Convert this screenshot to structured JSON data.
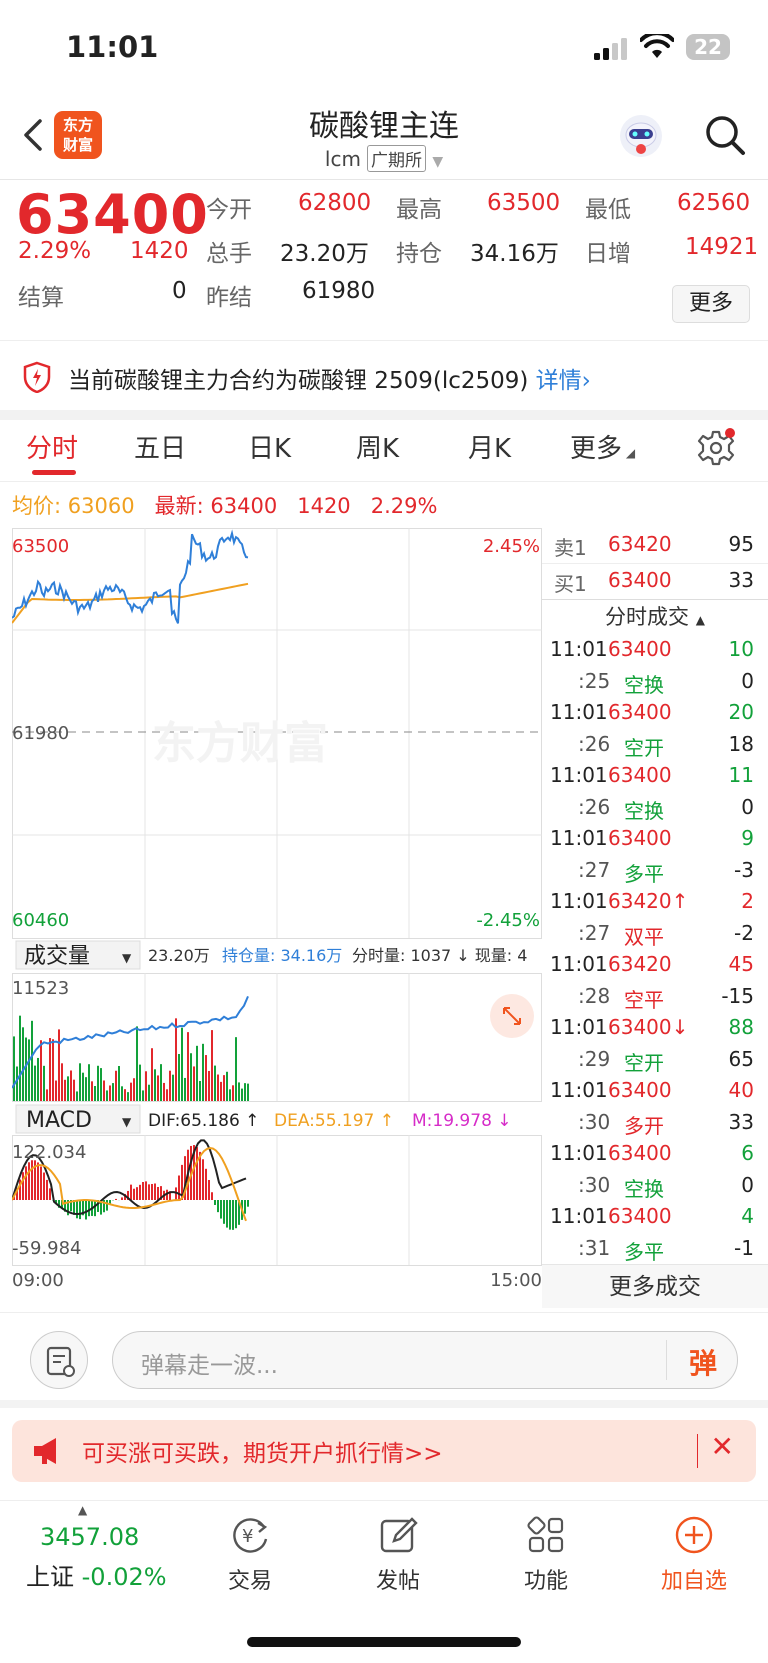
{
  "status_bar": {
    "time": "11:01",
    "battery": "22"
  },
  "header": {
    "logo_line1": "东方",
    "logo_line2": "财富",
    "title": "碳酸锂主连",
    "symbol": "lcm",
    "exchange": "广期所"
  },
  "quote": {
    "last": "63400",
    "pct": "2.29%",
    "change": "1420",
    "open_label": "今开",
    "open": "62800",
    "high_label": "最高",
    "high": "63500",
    "low_label": "最低",
    "low": "62560",
    "volume_label": "总手",
    "volume": "23.20万",
    "oi_label": "持仓",
    "oi": "34.16万",
    "daily_inc_label": "日增",
    "daily_inc": "14921",
    "settle_label": "结算",
    "settle": "0",
    "prev_settle_label": "昨结",
    "prev_settle": "61980",
    "more": "更多"
  },
  "notice": {
    "text": "当前碳酸锂主力合约为碳酸锂 2509(lc2509)",
    "link": "详情"
  },
  "tabs": [
    "分时",
    "五日",
    "日K",
    "周K",
    "月K",
    "更多"
  ],
  "avg_bar": {
    "avg_label": "均价:",
    "avg": "63060",
    "latest_label": "最新:",
    "latest": "63400",
    "change": "1420",
    "pct": "2.29%"
  },
  "price_chart": {
    "top": "63500",
    "mid": "61980",
    "bottom": "60460",
    "top_pct": "2.45%",
    "bottom_pct": "-2.45%",
    "watermark": "东方财富"
  },
  "volume_panel": {
    "label": "成交量",
    "text1": "23.20万",
    "text2": "持仓量: 34.16万",
    "text3": "分时量: 1037 ↓ 现量: 4",
    "max": "11523"
  },
  "macd_panel": {
    "label": "MACD",
    "dif": "DIF:65.186 ↑",
    "dea": "DEA:55.197 ↑",
    "m": "M:19.978 ↓",
    "top": "122.034",
    "bottom": "-59.984",
    "time_start": "09:00",
    "time_end": "15:00"
  },
  "orderbook": [
    {
      "label": "卖1",
      "price": "63420",
      "qty": "95"
    },
    {
      "label": "买1",
      "price": "63400",
      "qty": "33"
    }
  ],
  "ticks_header": "分时成交",
  "ticks": [
    {
      "t": "11:01",
      "p": "63400",
      "v": "10",
      "vc": "green"
    },
    {
      "t": ":25",
      "p": "空换",
      "v": "0",
      "pc": "green"
    },
    {
      "t": "11:01",
      "p": "63400",
      "v": "20",
      "vc": "green"
    },
    {
      "t": ":26",
      "p": "空开",
      "v": "18",
      "pc": "green"
    },
    {
      "t": "11:01",
      "p": "63400",
      "v": "11",
      "vc": "green"
    },
    {
      "t": ":26",
      "p": "空换",
      "v": "0",
      "pc": "green"
    },
    {
      "t": "11:01",
      "p": "63400",
      "v": "9",
      "vc": "green"
    },
    {
      "t": ":27",
      "p": "多平",
      "v": "-3",
      "pc": "green"
    },
    {
      "t": "11:01",
      "p": "63420↑",
      "v": "2",
      "vc": "red"
    },
    {
      "t": ":27",
      "p": "双平",
      "v": "-2",
      "pc": "red"
    },
    {
      "t": "11:01",
      "p": "63420",
      "v": "45",
      "vc": "red"
    },
    {
      "t": ":28",
      "p": "空平",
      "v": "-15",
      "pc": "red"
    },
    {
      "t": "11:01",
      "p": "63400↓",
      "v": "88",
      "vc": "green"
    },
    {
      "t": ":29",
      "p": "空开",
      "v": "65",
      "pc": "green"
    },
    {
      "t": "11:01",
      "p": "63400",
      "v": "40",
      "vc": "red"
    },
    {
      "t": ":30",
      "p": "多开",
      "v": "33",
      "pc": "red"
    },
    {
      "t": "11:01",
      "p": "63400",
      "v": "6",
      "vc": "green"
    },
    {
      "t": ":30",
      "p": "空换",
      "v": "0",
      "pc": "green"
    },
    {
      "t": "11:01",
      "p": "63400",
      "v": "4",
      "vc": "green"
    },
    {
      "t": ":31",
      "p": "多平",
      "v": "-1",
      "pc": "green"
    }
  ],
  "more_deals": "更多成交",
  "input": {
    "placeholder": "弹幕走一波...",
    "danmu": "弹"
  },
  "ad": {
    "text": "可买涨可买跌，期货开户抓行情>>"
  },
  "bottom_bar": {
    "index_value": "3457.08",
    "index_name": "上证",
    "index_pct": "-0.02%",
    "trade": "交易",
    "post": "发帖",
    "func": "功能",
    "add": "加自选"
  },
  "colors": {
    "up": "#e2282c",
    "down": "#12a13a",
    "price_line": "#2f7fd8",
    "avg_line": "#f0a020",
    "brand": "#f0541e"
  }
}
